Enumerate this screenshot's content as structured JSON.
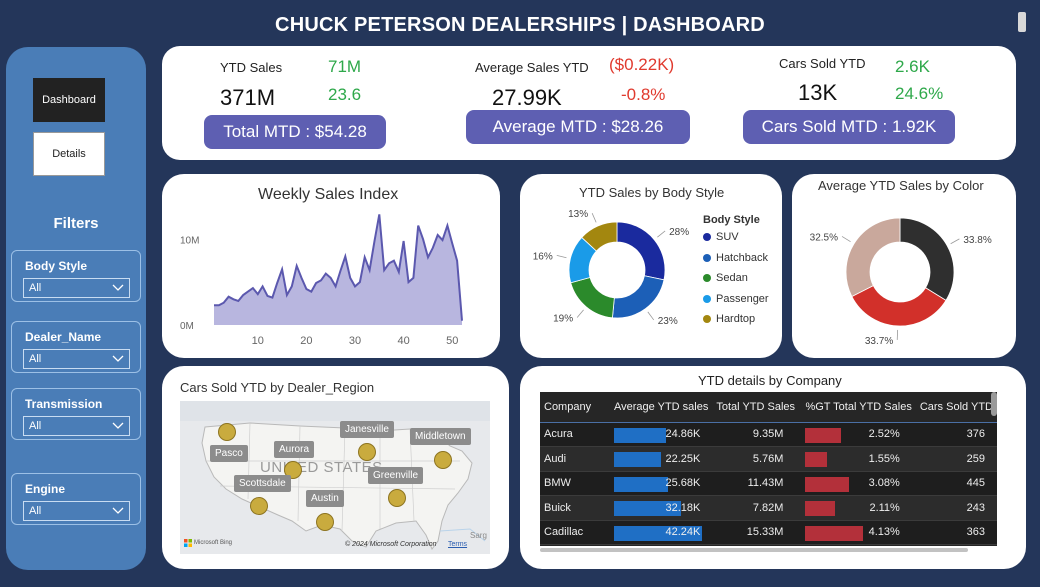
{
  "title": "CHUCK PETERSON DEALERSHIPS | DASHBOARD",
  "nav": {
    "dashboard": "Dashboard",
    "details": "Details"
  },
  "filters": {
    "title": "Filters",
    "items": [
      {
        "label": "Body Style",
        "value": "All"
      },
      {
        "label": "Dealer_Name",
        "value": "All"
      },
      {
        "label": "Transmission",
        "value": "All"
      },
      {
        "label": "Engine",
        "value": "All"
      }
    ]
  },
  "kpis": {
    "ytd_sales": {
      "label": "YTD Sales",
      "value": "371M",
      "delta1": "71M",
      "delta2": "23.6",
      "mtd": "Total MTD : $54.28"
    },
    "avg_sales": {
      "label": "Average Sales YTD",
      "value": "27.99K",
      "delta1": "($0.22K)",
      "delta2": "-0.8%",
      "mtd": "Average MTD : $28.26"
    },
    "cars_sold": {
      "label": "Cars Sold YTD",
      "value": "13K",
      "delta1": "2.6K",
      "delta2": "24.6%",
      "mtd": "Cars Sold MTD : 1.92K"
    }
  },
  "colors": {
    "accent": "#5e5fb2",
    "positive": "#2ea84a",
    "negative": "#e03a2e",
    "area_fill": "#b8b6df",
    "area_line": "#5b58ae"
  },
  "weekly": {
    "title": "Weekly Sales Index",
    "chart_data": {
      "type": "area",
      "title": "Weekly Sales Index",
      "xlabel": "",
      "ylabel": "",
      "xticks": [
        10,
        20,
        30,
        40,
        50
      ],
      "yticks": [
        "0M",
        "10M"
      ],
      "xlim": [
        1,
        52
      ],
      "ylim": [
        0,
        14
      ],
      "x": [
        1,
        2,
        3,
        4,
        5,
        6,
        7,
        8,
        9,
        10,
        11,
        12,
        13,
        14,
        15,
        16,
        17,
        18,
        19,
        20,
        21,
        22,
        23,
        24,
        25,
        26,
        27,
        28,
        29,
        30,
        31,
        32,
        33,
        34,
        35,
        36,
        37,
        38,
        39,
        40,
        41,
        42,
        43,
        44,
        45,
        46,
        47,
        48,
        49,
        50,
        51,
        52
      ],
      "values": [
        2.3,
        2.3,
        2.6,
        3.3,
        3.0,
        2.8,
        3.5,
        3.9,
        4.3,
        3.6,
        4.5,
        3.4,
        3.2,
        4.9,
        6.5,
        3.5,
        4.5,
        6.9,
        5.5,
        4.2,
        3.9,
        4.9,
        5.2,
        6.0,
        5.5,
        4.5,
        6.3,
        8.0,
        5.5,
        4.5,
        5.0,
        7.9,
        6.4,
        9.8,
        12.9,
        6.4,
        7.2,
        7.5,
        6.2,
        9.8,
        5.0,
        5.5,
        11.6,
        10.0,
        7.9,
        9.0,
        10.5,
        9.9,
        11.6,
        9.5,
        7.5,
        0.5
      ]
    }
  },
  "body_style": {
    "title": "YTD Sales by Body Style",
    "legend_title": "Body Style",
    "chart_data": {
      "type": "pie",
      "title": "YTD Sales by Body Style",
      "labels": [
        "SUV",
        "Hatchback",
        "Sedan",
        "Passenger",
        "Hardtop"
      ],
      "values": [
        28,
        23,
        19,
        16,
        13
      ],
      "value_labels": [
        "28%",
        "23%",
        "19%",
        "16%",
        "13%"
      ],
      "colors": [
        "#1a2a9e",
        "#1c5fb7",
        "#2b8a2b",
        "#1a9be8",
        "#a3870f"
      ],
      "legend_position": "right"
    }
  },
  "color_sales": {
    "title": "Average YTD Sales by Color",
    "chart_data": {
      "type": "pie",
      "title": "Average YTD Sales by Color",
      "labels": [
        "",
        "",
        ""
      ],
      "values": [
        33.8,
        33.7,
        32.5
      ],
      "value_labels": [
        "33.8%",
        "33.7%",
        "32.5%"
      ],
      "colors": [
        "#2f2f2f",
        "#d2302a",
        "#c9a89c"
      ]
    }
  },
  "map": {
    "title": "Cars Sold YTD by Dealer_Region",
    "country_label": "UNITED STATES",
    "regions": [
      "Pasco",
      "Aurora",
      "Janesville",
      "Middletown",
      "Scottsdale",
      "Greenville",
      "Austin"
    ],
    "attribution_left": "Microsoft Bing",
    "attribution_right": "© 2024 Microsoft Corporation",
    "terms": "Terms",
    "extra": "Sarg"
  },
  "company_table": {
    "title": "YTD details by Company",
    "columns": [
      "Company",
      "Average YTD sales",
      "Total YTD Sales",
      "%GT Total YTD Sales",
      "Cars Sold YTD"
    ],
    "rows": [
      {
        "company": "Acura",
        "avg": "24.86K",
        "total": "9.35M",
        "pct": "2.52%",
        "cars": "376"
      },
      {
        "company": "Audi",
        "avg": "22.25K",
        "total": "5.76M",
        "pct": "1.55%",
        "cars": "259"
      },
      {
        "company": "BMW",
        "avg": "25.68K",
        "total": "11.43M",
        "pct": "3.08%",
        "cars": "445"
      },
      {
        "company": "Buick",
        "avg": "32.18K",
        "total": "7.82M",
        "pct": "2.11%",
        "cars": "243"
      },
      {
        "company": "Cadillac",
        "avg": "42.24K",
        "total": "15.33M",
        "pct": "4.13%",
        "cars": "363"
      }
    ],
    "bar_fractions": {
      "avg": [
        0.59,
        0.53,
        0.61,
        0.76,
        1.0
      ],
      "pct": [
        0.61,
        0.38,
        0.75,
        0.51,
        1.0
      ]
    },
    "bar_colors": {
      "avg": "#1f6fc5",
      "pct": "#b3303a"
    }
  }
}
